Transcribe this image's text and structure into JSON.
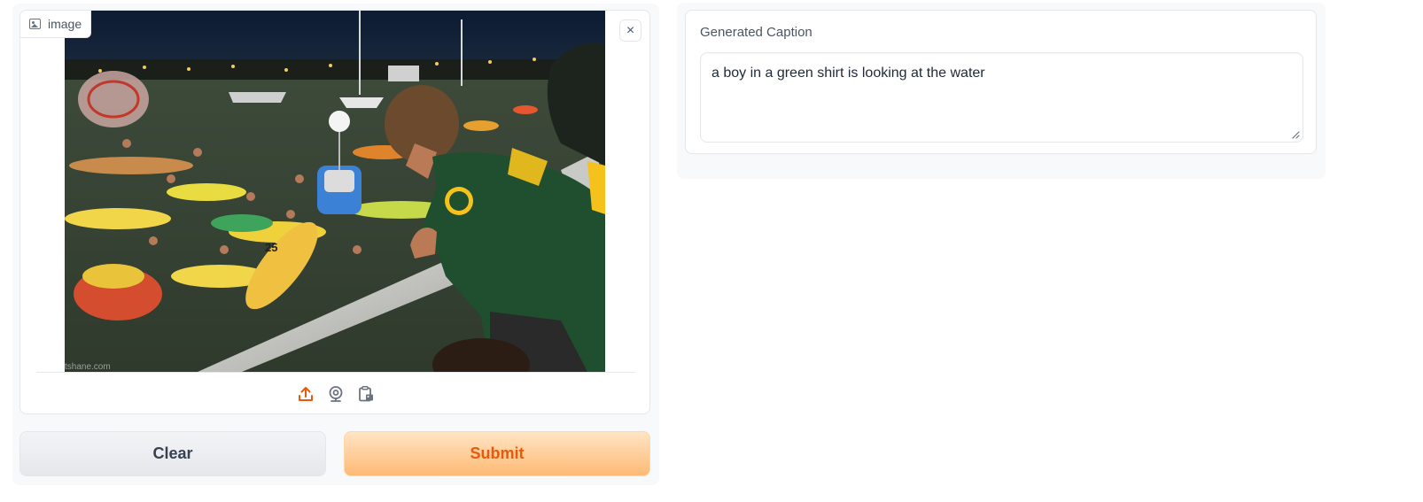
{
  "input": {
    "label": "image",
    "label_icon": "image-icon",
    "close_symbol": "×",
    "photo_watermark": "tshane.com",
    "jersey_number": "25",
    "sources": [
      {
        "icon": "upload-icon",
        "active": true
      },
      {
        "icon": "webcam-icon",
        "active": false
      },
      {
        "icon": "clipboard-icon",
        "active": false
      }
    ]
  },
  "actions": {
    "clear_label": "Clear",
    "submit_label": "Submit"
  },
  "output": {
    "label": "Generated Caption",
    "caption": "a boy in a green shirt is looking at the water"
  },
  "colors": {
    "accent": "#ea580c",
    "submit_bg": "#fdba74",
    "panel_bg": "#f8f9fb",
    "border": "#e5e7eb"
  }
}
